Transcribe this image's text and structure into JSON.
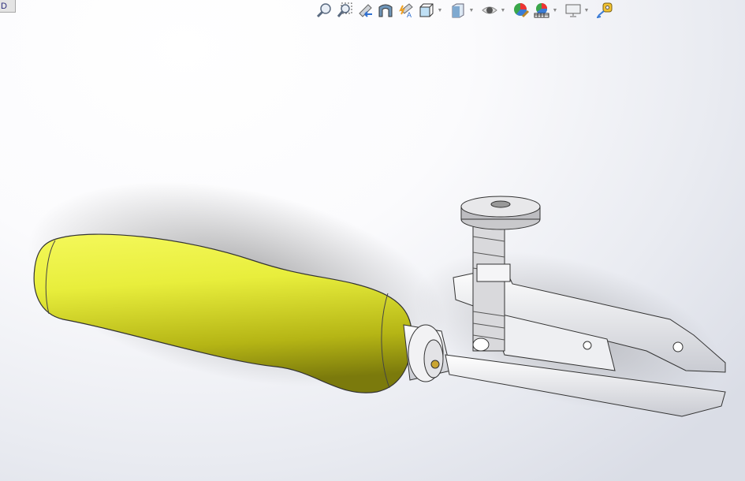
{
  "tab_label": "D",
  "toolbar": [
    {
      "icon": "zoom-to-fit-icon",
      "dropdown": false
    },
    {
      "icon": "zoom-to-area-icon",
      "dropdown": false
    },
    {
      "icon": "previous-view-icon",
      "dropdown": false
    },
    {
      "icon": "section-view-icon",
      "dropdown": false
    },
    {
      "icon": "dynamic-annotation-views-icon",
      "dropdown": false
    },
    {
      "icon": "view-orientation-icon",
      "dropdown": true
    },
    {
      "icon": "display-style-icon",
      "dropdown": true
    },
    {
      "icon": "hide-show-items-icon",
      "dropdown": true
    },
    {
      "icon": "edit-appearance-icon",
      "dropdown": false
    },
    {
      "icon": "apply-scene-icon",
      "dropdown": true
    },
    {
      "icon": "view-settings-icon",
      "dropdown": true
    },
    {
      "icon": "measure-icon",
      "dropdown": false
    }
  ],
  "colors": {
    "handle": "#e5ec3a",
    "metal": "#f4f4f6",
    "accent": "#3a7bd5"
  }
}
